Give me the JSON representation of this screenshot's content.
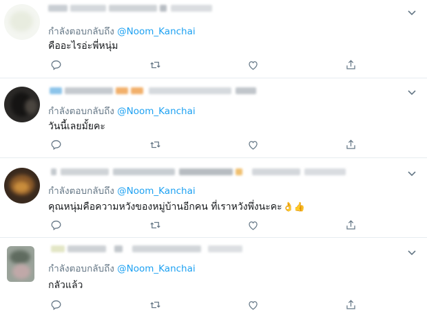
{
  "feed": {
    "reply_prefix": "กำลังตอบกลับถึง",
    "reply_handle": "@Noom_Kanchai",
    "colors": {
      "handle": "#1da1f2",
      "muted": "#657786",
      "text": "#14171a",
      "divider": "#e6ecf0"
    },
    "icons": {
      "reply": "reply-icon",
      "retweet": "retweet-icon",
      "like": "heart-icon",
      "share": "share-icon",
      "menu": "chevron-down-icon"
    },
    "tweets": [
      {
        "text": "คืออะไรอ่ะพี่หนุ่ม",
        "emoji": ""
      },
      {
        "text": "วันนี้เลยมั้ยคะ",
        "emoji": ""
      },
      {
        "text": "คุณหนุ่มคือความหวังของหมู่บ้านอีกคน ที่เราหวังพึ่งนะคะ",
        "emoji": "👌👍"
      },
      {
        "text": "กลัวแล้ว",
        "emoji": ""
      }
    ]
  }
}
